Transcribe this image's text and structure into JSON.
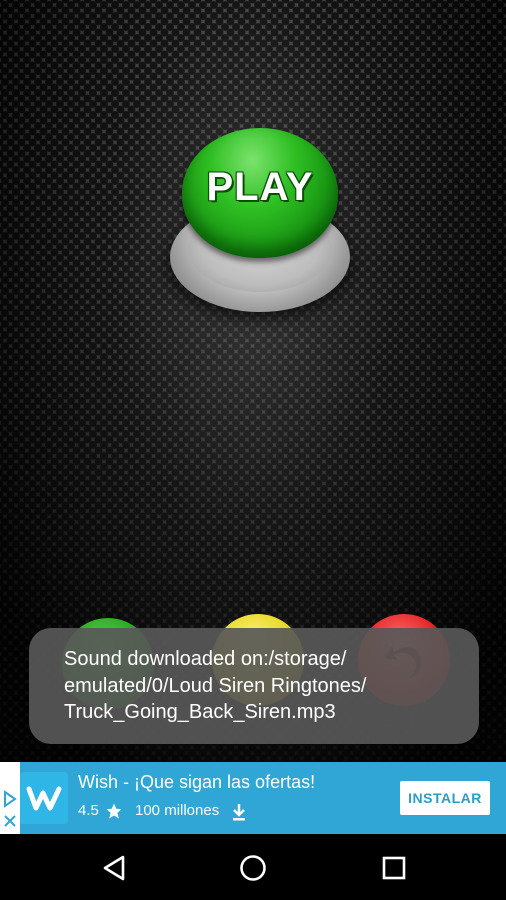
{
  "play_button": {
    "label": "PLAY"
  },
  "toast": {
    "lines": [
      "Sound downloaded on:/storage/",
      "emulated/0/Loud Siren Ringtones/",
      "Truck_Going_Back_Siren.mp3"
    ]
  },
  "ad": {
    "title": "Wish - ¡Que sigan las ofertas!",
    "rating": "4.5",
    "installs": "100 millones",
    "cta_label": "INSTALAR",
    "logo_letter": "w",
    "icons": {
      "choices": "adchoices-icon",
      "close": "close-icon",
      "star": "star-icon",
      "download": "download-icon"
    },
    "colors": {
      "background": "#2fa6d6",
      "logo": "#2fb6e6",
      "cta_text": "#2c9cc9"
    }
  },
  "small_buttons": [
    {
      "color": "#1f9a17"
    },
    {
      "color": "#e1cf12"
    },
    {
      "color": "#dd1515",
      "icon": "undo-icon"
    }
  ],
  "navbar": {
    "icons": [
      "back-icon",
      "home-icon",
      "recents-icon"
    ]
  }
}
